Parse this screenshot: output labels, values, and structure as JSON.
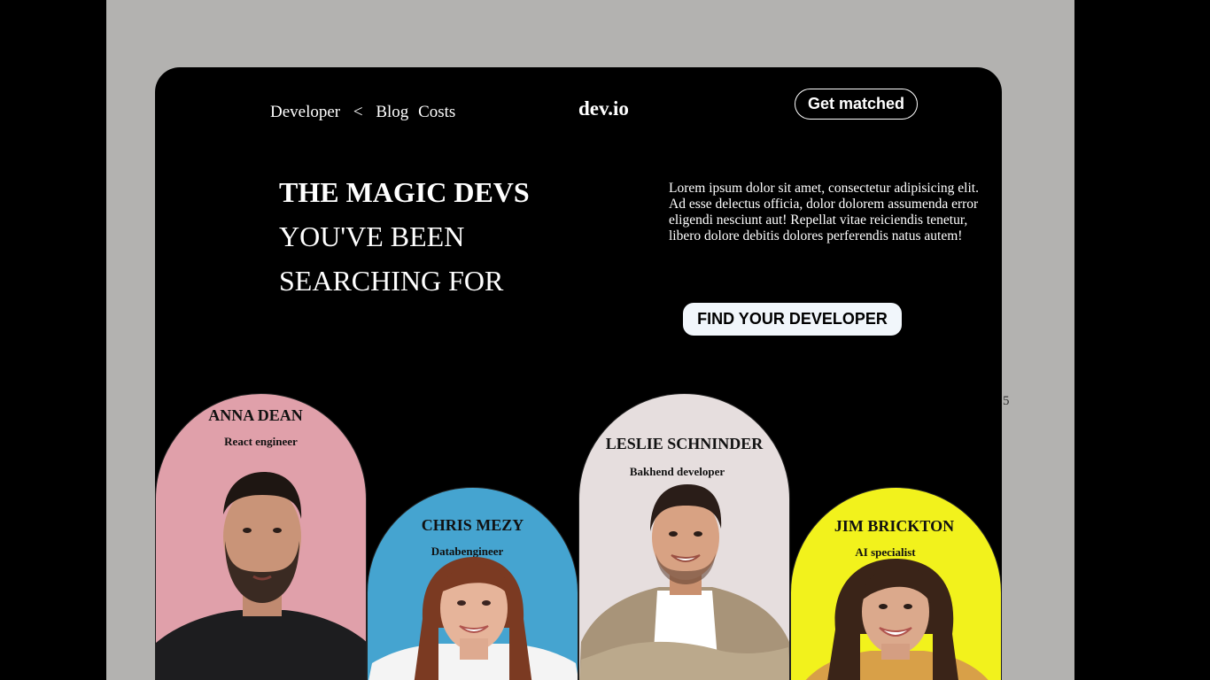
{
  "nav": {
    "items": [
      "Developer",
      "<",
      "Blog",
      "Costs"
    ]
  },
  "brand": "dev.io",
  "get_matched_label": "Get matched",
  "hero": {
    "line1": "THE MAGIC DEVS",
    "line2": "YOU'VE BEEN",
    "line3": "SEARCHING FOR",
    "intro": "Lorem ipsum dolor sit amet, consectetur adipisicing elit. Ad esse delectus officia, dolor dolorem assumenda error eligendi nesciunt aut! Repellat vitae reiciendis tenetur, libero dolore debitis dolores perferendis natus autem!",
    "cta_label": "FIND YOUR DEVELOPER"
  },
  "developers": [
    {
      "name": "ANNA DEAN",
      "role": "React engineer",
      "color": "#e0a0aa"
    },
    {
      "name": "CHRIS MEZY",
      "role": "Databengineer",
      "color": "#45a4d0"
    },
    {
      "name": "LESLIE SCHNINDER",
      "role": "Bakhend developer",
      "color": "#e6dede"
    },
    {
      "name": "JIM BRICKTON",
      "role": "AI specialist",
      "color": "#f2f21c"
    }
  ],
  "stray_text": "5",
  "colors": {
    "outer_bg": "#b3b2b0",
    "card_bg": "#000000",
    "cta_bg": "#f1f6fb"
  }
}
